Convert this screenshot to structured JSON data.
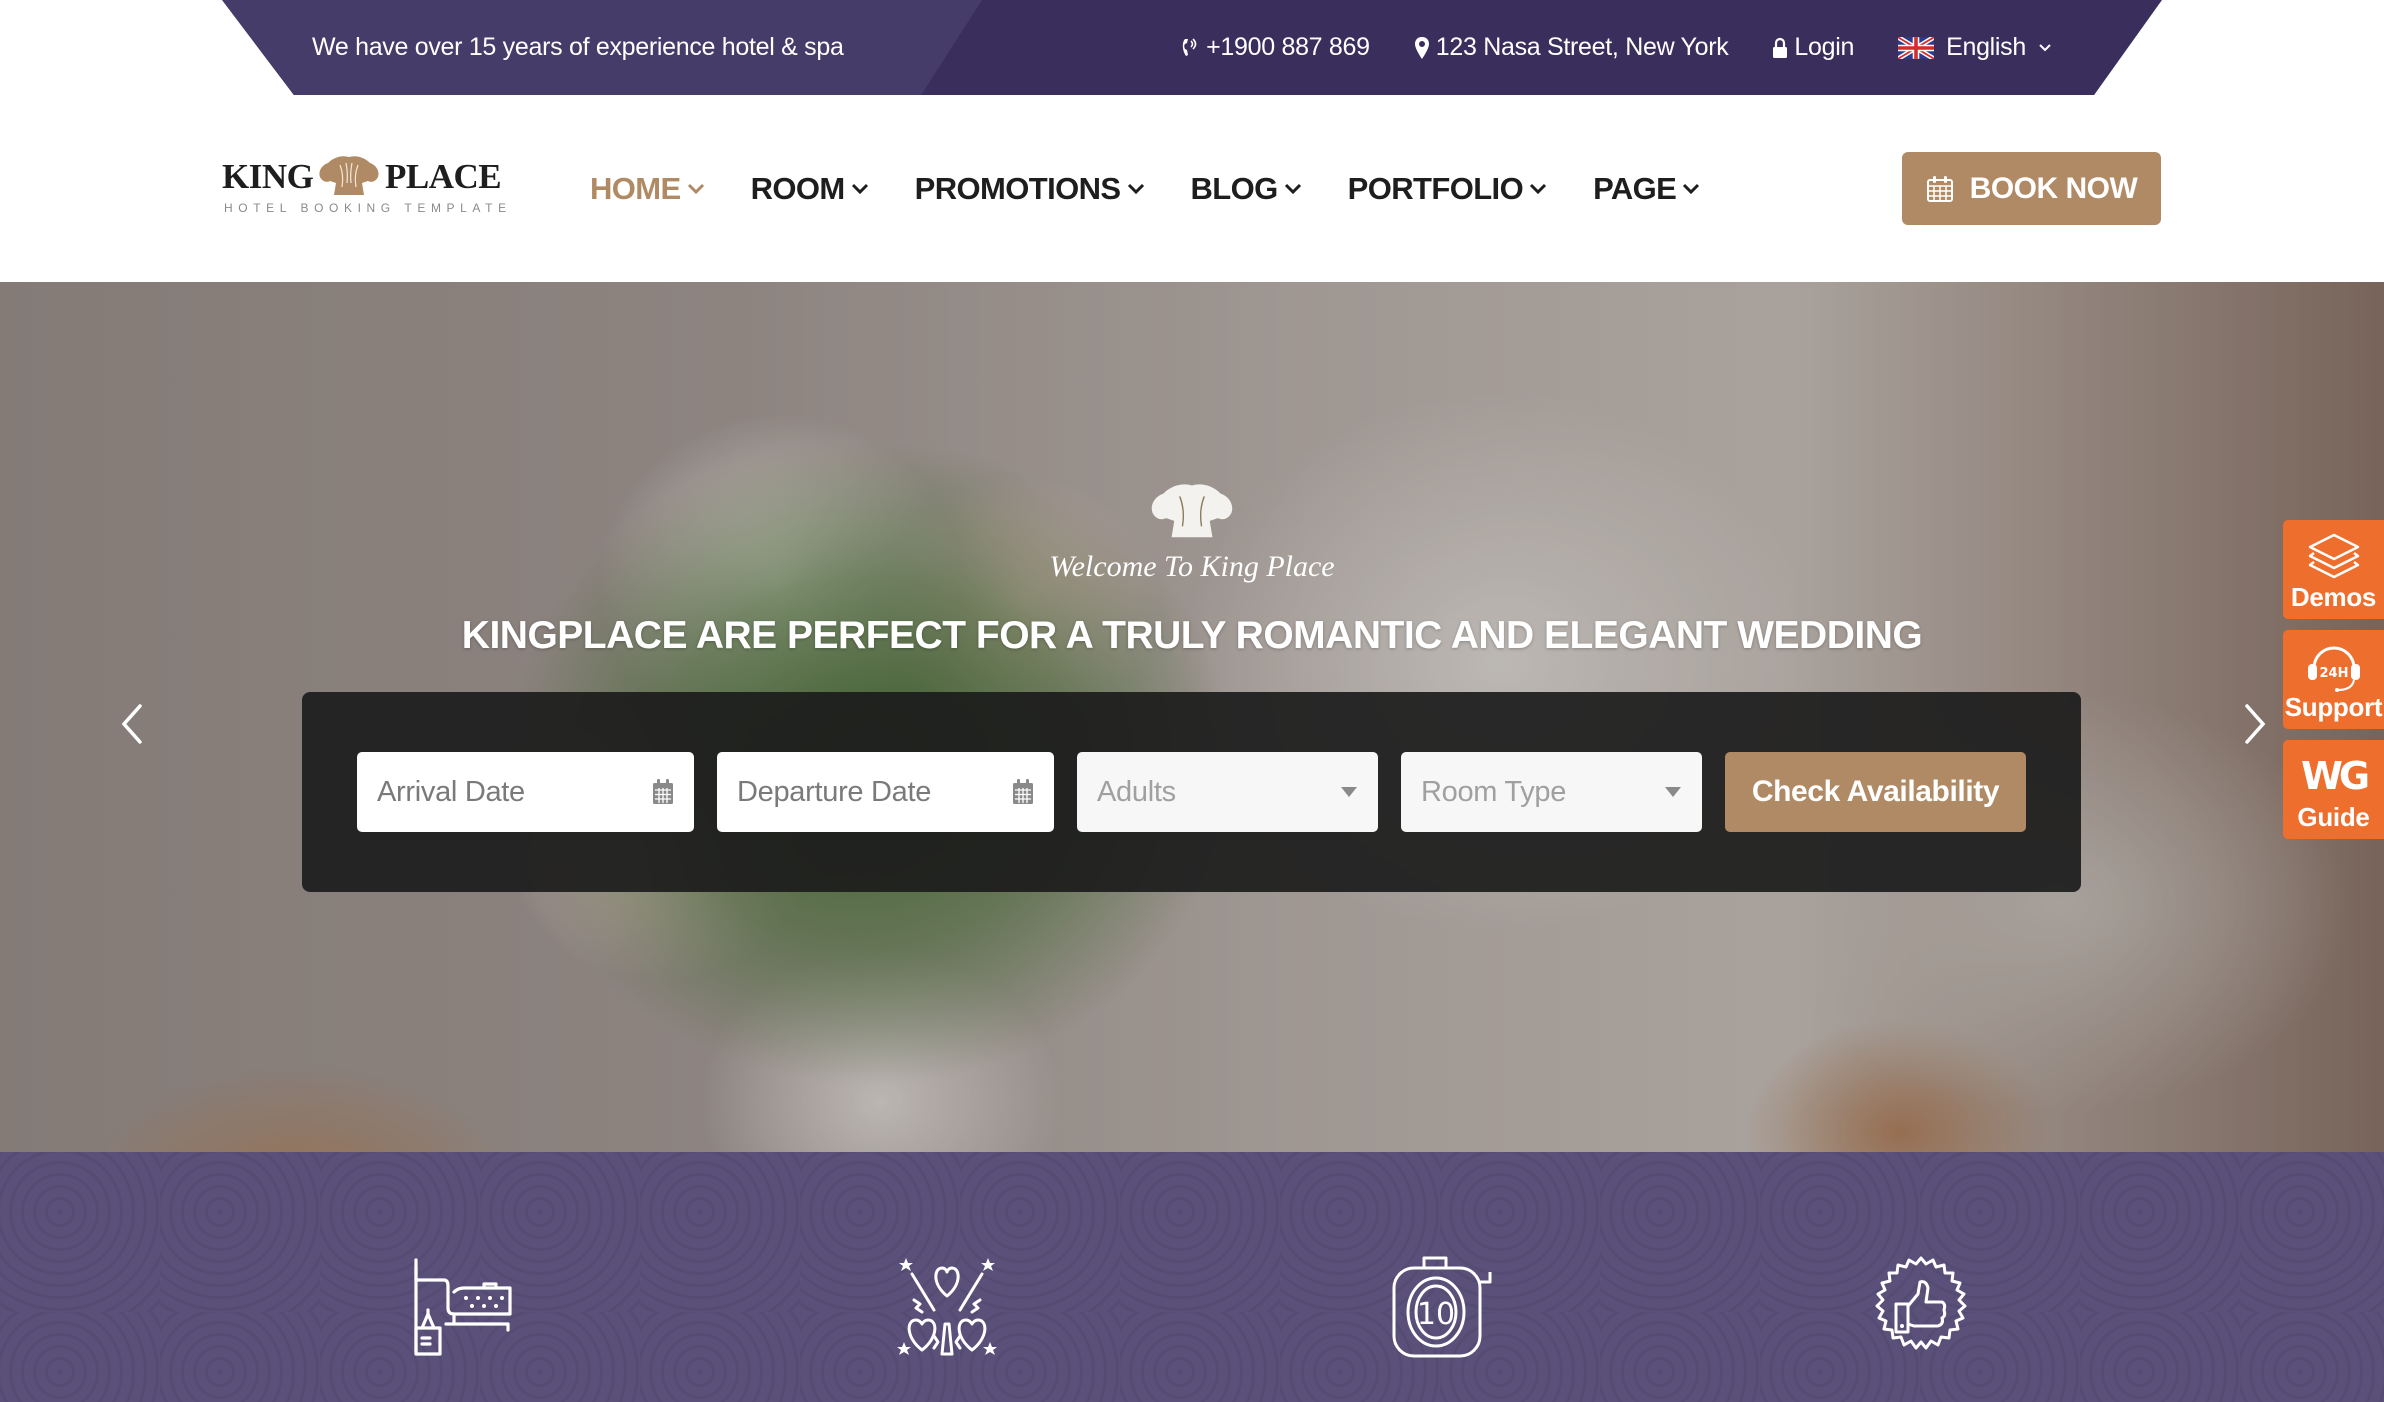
{
  "topbar": {
    "tagline": "We have over 15 years of experience hotel & spa",
    "phone": "+1900 887 869",
    "address": "123 Nasa Street, New York",
    "login": "Login",
    "language": "English"
  },
  "header": {
    "logo": {
      "word1": "KING",
      "word2": "PLACE",
      "subtitle": "HOTEL BOOKING TEMPLATE"
    },
    "nav": [
      {
        "label": "HOME",
        "active": true
      },
      {
        "label": "ROOM"
      },
      {
        "label": "PROMOTIONS"
      },
      {
        "label": "BLOG"
      },
      {
        "label": "PORTFOLIO"
      },
      {
        "label": "PAGE"
      }
    ],
    "book_now": "BOOK NOW"
  },
  "hero": {
    "welcome": "Welcome To King Place",
    "title": "KINGPLACE ARE PERFECT FOR A TRULY ROMANTIC AND ELEGANT WEDDING",
    "booking": {
      "arrival_placeholder": "Arrival Date",
      "departure_placeholder": "Departure Date",
      "adults_placeholder": "Adults",
      "room_type_placeholder": "Room Type",
      "submit": "Check Availability"
    }
  },
  "side_widgets": [
    {
      "label": "Demos",
      "icon": "layers-icon"
    },
    {
      "label": "Support",
      "icon": "headset-24h-icon"
    },
    {
      "label": "Guide",
      "icon": "wg-logo-icon",
      "mark": "WG"
    }
  ],
  "features": {
    "icons": [
      "bed-icon",
      "fireworks-hearts-icon",
      "tape-measure-10-icon",
      "thumbs-up-badge-icon"
    ]
  },
  "colors": {
    "topbar": "#3a2f5c",
    "accent": "#b08a64",
    "widget": "#ee6f2d",
    "features_bg": "#5a507a"
  }
}
